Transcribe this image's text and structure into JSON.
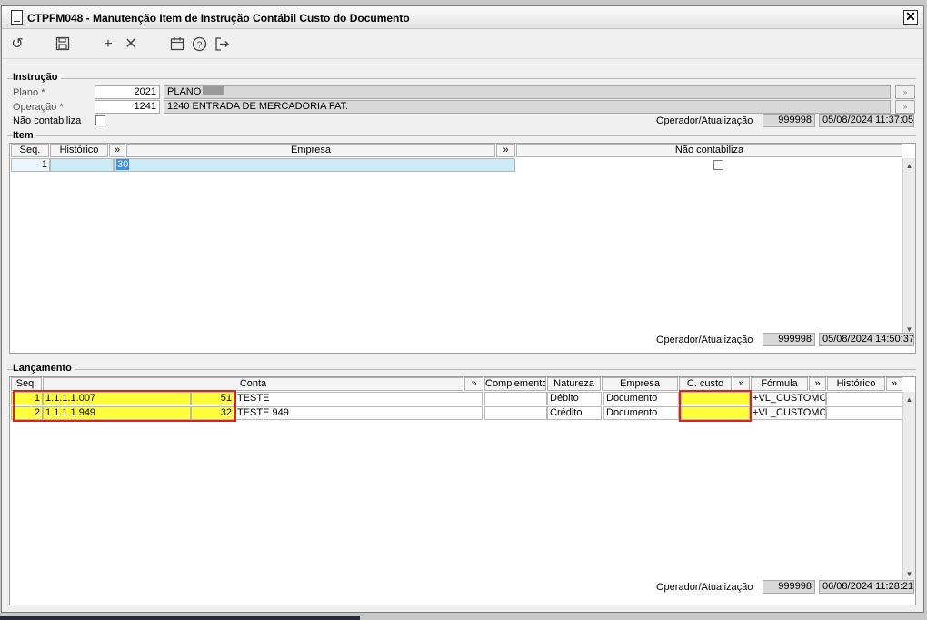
{
  "window": {
    "title": "CTPFM048 - Manutenção Item de Instrução Contábil Custo do Documento"
  },
  "toolbar": {
    "icons": [
      "undo-icon",
      "save-icon",
      "add-icon",
      "delete-icon",
      "calendar-icon",
      "help-icon",
      "exit-icon"
    ]
  },
  "instrucao": {
    "heading": "Instrução",
    "plano_label": "Plano *",
    "plano_code": "2021",
    "plano_desc": "PLANO",
    "operacao_label": "Operação *",
    "operacao_code": "1241",
    "operacao_desc": "1240 ENTRADA DE MERCADORIA FAT.",
    "nao_contabiliza_label": "Não contabiliza",
    "operador_label": "Operador/Atualização",
    "operador": "999998",
    "atualizacao": "05/08/2024 11:37:05"
  },
  "item": {
    "heading": "Item",
    "columns": [
      "Seq.",
      "Histórico",
      "»",
      "Empresa",
      "»",
      "Não contabiliza"
    ],
    "rows": [
      {
        "seq": "1",
        "historico": "",
        "empresa": "30"
      }
    ],
    "operador_label": "Operador/Atualização",
    "operador": "999998",
    "atualizacao": "05/08/2024 14:50:37"
  },
  "lancamento": {
    "heading": "Lançamento",
    "columns": [
      "Seq.",
      "Conta",
      "»",
      "Complemento",
      "Natureza",
      "Empresa",
      "C. custo",
      "»",
      "Fórmula",
      "»",
      "Histórico",
      "»"
    ],
    "rows": [
      {
        "seq": "1",
        "conta": "1.1.1.1.007",
        "conta_num": "51",
        "conta_desc": "TESTE",
        "complemento": "",
        "natureza": "Débito",
        "empresa": "Documento",
        "ccusto": "",
        "formula": "+VL_CUSTOMCM",
        "historico": ""
      },
      {
        "seq": "2",
        "conta": "1.1.1.1.949",
        "conta_num": "32",
        "conta_desc": "TESTE 949",
        "complemento": "",
        "natureza": "Crédito",
        "empresa": "Documento",
        "ccusto": "",
        "formula": "+VL_CUSTOMCM",
        "historico": ""
      }
    ],
    "operador_label": "Operador/Atualização",
    "operador": "999998",
    "atualizacao": "06/08/2024 11:28:21"
  },
  "colors": {
    "highlight_yellow": "#ffff3a",
    "selection_blue": "#cdeaf7",
    "annotation_red": "#e02020"
  }
}
